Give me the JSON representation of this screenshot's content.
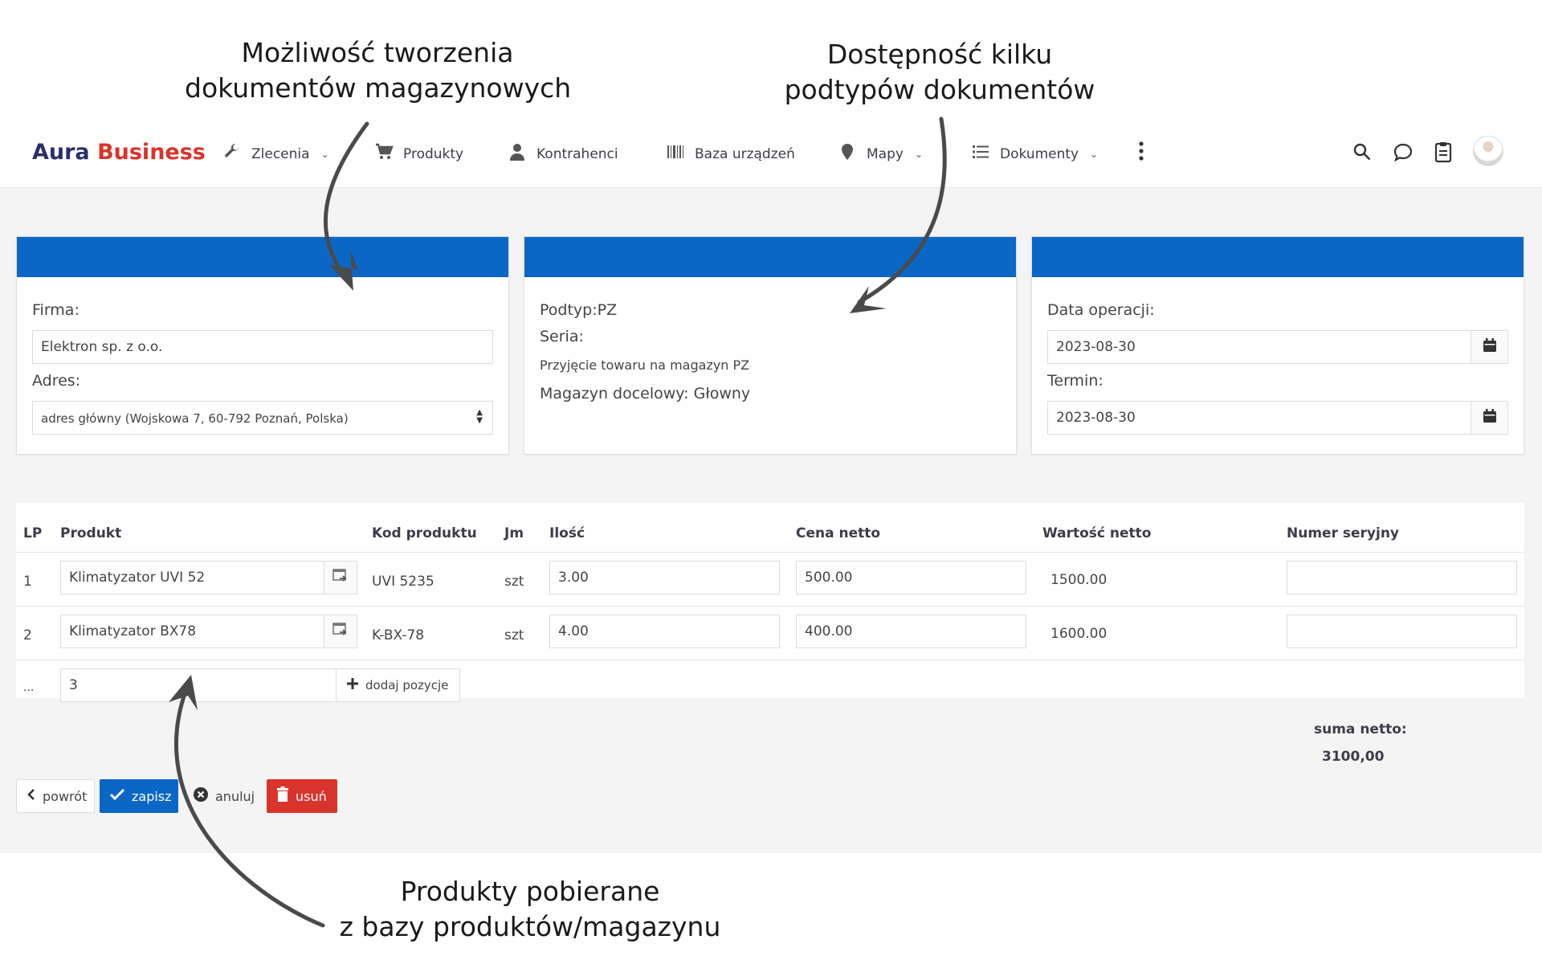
{
  "annotations": {
    "top_left_line1": "Możliwość tworzenia",
    "top_left_line2": "dokumentów magazynowych",
    "top_right_line1": "Dostępność kilku",
    "top_right_line2": "podtypów dokumentów",
    "bottom_line1": "Produkty pobierane",
    "bottom_line2": "z bazy produktów/magazynu"
  },
  "brand": {
    "part1": "Aura",
    "part2": "Business"
  },
  "nav": {
    "zlecenia": "Zlecenia",
    "produkty": "Produkty",
    "kontrahenci": "Kontrahenci",
    "baza": "Baza urządzeń",
    "mapy": "Mapy",
    "dokumenty": "Dokumenty"
  },
  "card1": {
    "firma_label": "Firma:",
    "firma_value": "Elektron sp. z o.o.",
    "adres_label": "Adres:",
    "adres_value": "adres główny (Wojskowa 7, 60-792 Poznań, Polska)"
  },
  "card2": {
    "podtyp": "Podtyp:PZ",
    "seria": "Seria:",
    "opis": "Przyjęcie towaru na magazyn PZ",
    "magazyn": "Magazyn docelowy: Głowny"
  },
  "card3": {
    "data_label": "Data operacji:",
    "data_value": "2023-08-30",
    "termin_label": "Termin:",
    "termin_value": "2023-08-30"
  },
  "table": {
    "headers": {
      "lp": "LP",
      "produkt": "Produkt",
      "kod": "Kod produktu",
      "jm": "Jm",
      "ilosc": "Ilość",
      "cena": "Cena netto",
      "wartosc": "Wartość netto",
      "numer": "Numer seryjny"
    },
    "rows": [
      {
        "lp": "1",
        "produkt": "Klimatyzator UVI 52",
        "kod": "UVI 5235",
        "jm": "szt",
        "ilosc": "3.00",
        "cena": "500.00",
        "wartosc": "1500.00",
        "numer": ""
      },
      {
        "lp": "2",
        "produkt": "Klimatyzator BX78",
        "kod": "K-BX-78",
        "jm": "szt",
        "ilosc": "4.00",
        "cena": "400.00",
        "wartosc": "1600.00",
        "numer": ""
      }
    ],
    "new_row": {
      "lp": "...",
      "value": "3",
      "add_label": "dodaj pozycje"
    }
  },
  "summary": {
    "label": "suma netto:",
    "value": "3100,00"
  },
  "buttons": {
    "back": "powrót",
    "save": "zapisz",
    "cancel": "anuluj",
    "delete": "usuń"
  },
  "colors": {
    "primary": "#0a67c6",
    "danger": "#d9342b",
    "brand_dark": "#2b2f6b"
  }
}
